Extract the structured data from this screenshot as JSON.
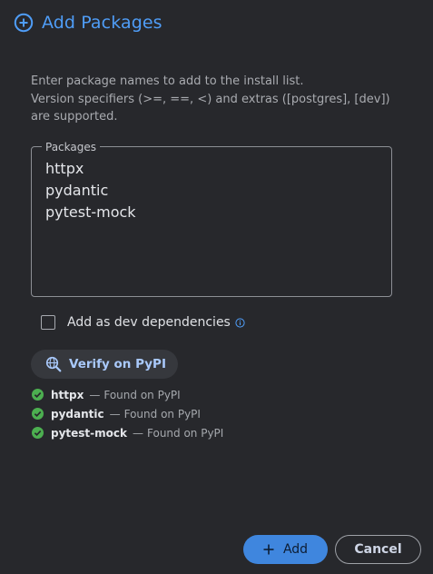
{
  "dialog": {
    "title": "Add Packages",
    "title_icon": "add-circle-icon",
    "accent_color": "#4f9df7"
  },
  "description": {
    "line1": "Enter package names to add to the install list.",
    "line2": "Version specifiers (>=, ==, <) and extras ([postgres], [dev]) are supported."
  },
  "packages_field": {
    "label": "Packages",
    "lines": [
      "httpx",
      "pydantic",
      "pytest-mock"
    ]
  },
  "dev_dependencies": {
    "label": "Add as dev dependencies",
    "checked": false,
    "info_icon": "info-icon"
  },
  "verify": {
    "label": "Verify on PyPI",
    "icon": "search-globe-icon"
  },
  "results": [
    {
      "name": "httpx",
      "separator": "—",
      "status": "Found on PyPI",
      "icon": "check-circle-icon",
      "color": "#4caf50"
    },
    {
      "name": "pydantic",
      "separator": "—",
      "status": "Found on PyPI",
      "icon": "check-circle-icon",
      "color": "#4caf50"
    },
    {
      "name": "pytest-mock",
      "separator": "—",
      "status": "Found on PyPI",
      "icon": "check-circle-icon",
      "color": "#4caf50"
    }
  ],
  "actions": {
    "add_label": "Add",
    "add_icon": "plus-icon",
    "cancel_label": "Cancel"
  }
}
